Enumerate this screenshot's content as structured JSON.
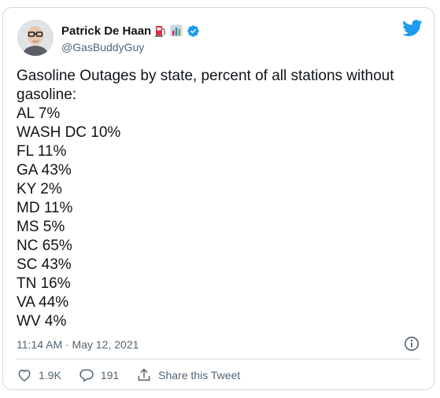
{
  "author": {
    "display_name": "Patrick De Haan",
    "handle": "@GasBuddyGuy",
    "name_emojis": [
      "fuel-pump-emoji",
      "bar-chart-emoji"
    ],
    "verified": true
  },
  "tweet": {
    "text": "Gasoline Outages by state, percent of all stations without gasoline:\nAL 7%\nWASH DC 10%\nFL 11%\nGA 43%\nKY 2%\nMD 11%\nMS 5%\nNC 65%\nSC 43%\nTN 16%\nVA 44%\nWV 4%",
    "timestamp": "11:14 AM · May 12, 2021"
  },
  "actions": {
    "like_count": "1.9K",
    "reply_count": "191",
    "share_label": "Share this Tweet"
  },
  "icons": [
    "twitter-bird-icon",
    "verified-badge-icon",
    "info-icon",
    "heart-icon",
    "reply-icon",
    "share-icon"
  ],
  "colors": {
    "brand_blue": "#1d9bf0",
    "text_primary": "#0f1419",
    "text_secondary": "#536471",
    "border": "#cfd9de"
  }
}
